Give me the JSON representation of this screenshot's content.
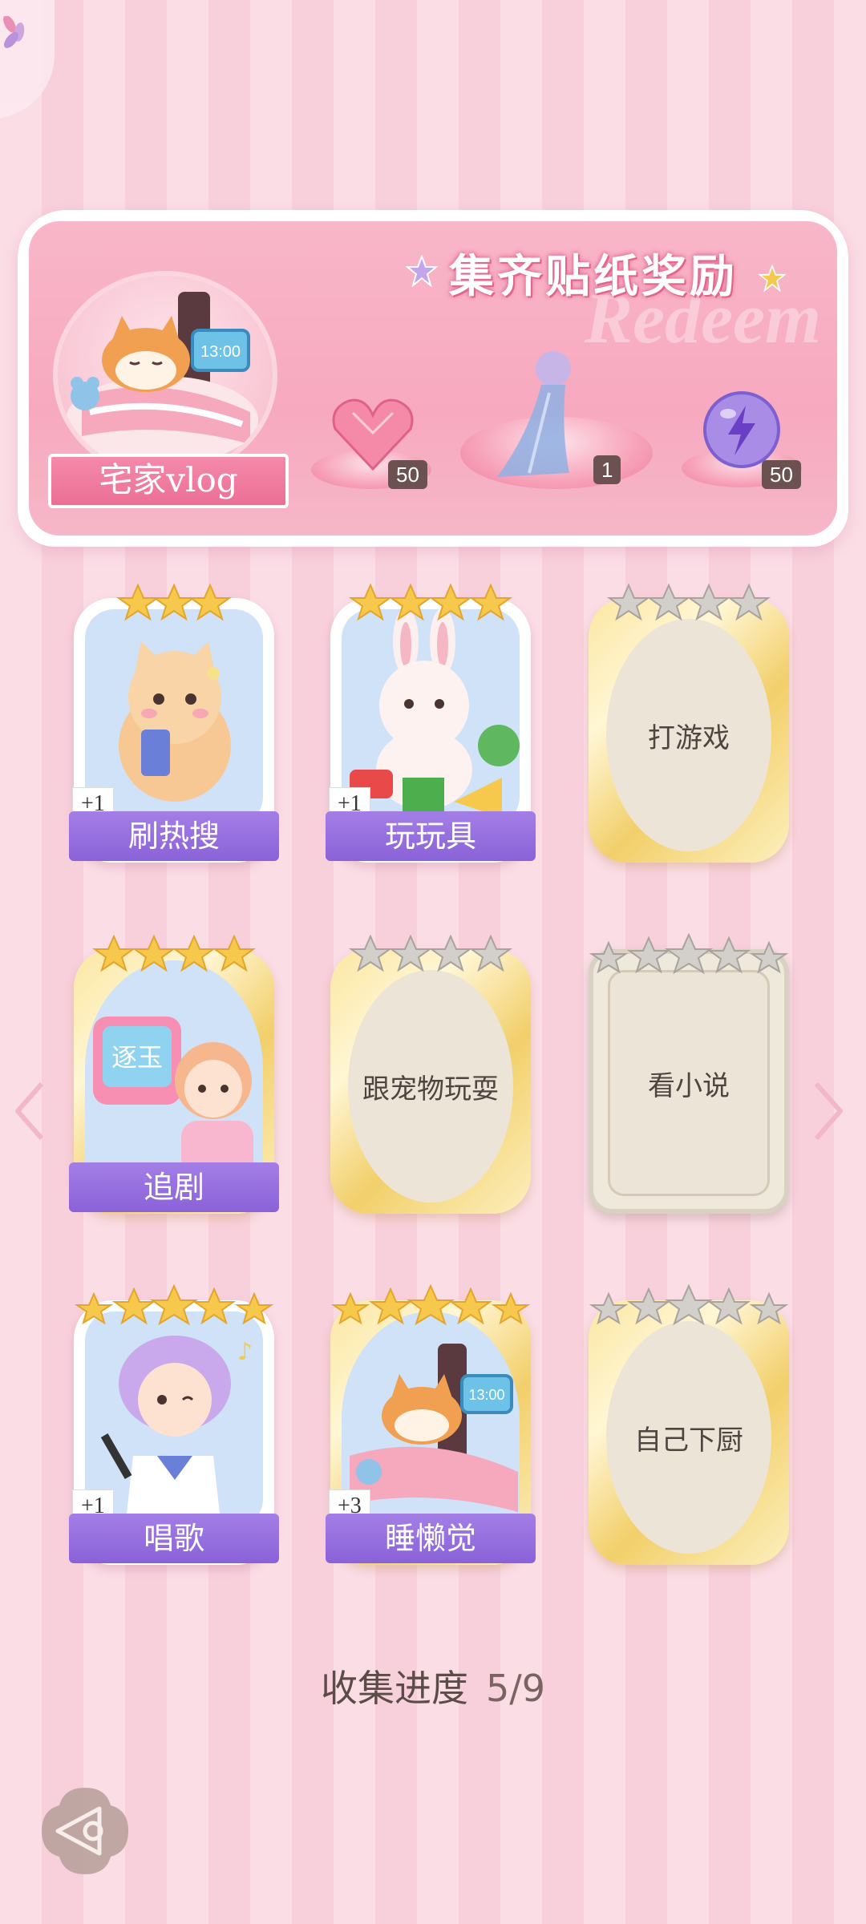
{
  "banner": {
    "title": "集齐贴纸奖励",
    "watermark": "Redeem",
    "theme_label": "宅家vlog",
    "rewards": [
      {
        "name": "heart-gem",
        "count": "50"
      },
      {
        "name": "outfit",
        "count": "1"
      },
      {
        "name": "energy-orb",
        "count": "50"
      }
    ]
  },
  "cards": [
    {
      "label": "刷热搜",
      "status": "collected",
      "stars": 3,
      "bonus": "+1"
    },
    {
      "label": "玩玩具",
      "status": "collected",
      "stars": 4,
      "bonus": "+1"
    },
    {
      "label": "打游戏",
      "status": "locked",
      "stars": 4,
      "bonus": ""
    },
    {
      "label": "追剧",
      "status": "collected",
      "stars": 4,
      "bonus": "",
      "tv_text": "逐玉"
    },
    {
      "label": "跟宠物玩耍",
      "status": "locked",
      "stars": 4,
      "bonus": ""
    },
    {
      "label": "看小说",
      "status": "locked",
      "stars": 5,
      "bonus": ""
    },
    {
      "label": "唱歌",
      "status": "collected",
      "stars": 5,
      "bonus": "+1"
    },
    {
      "label": "睡懒觉",
      "status": "collected",
      "stars": 5,
      "bonus": "+3",
      "clock_text": "13:00"
    },
    {
      "label": "自己下厨",
      "status": "locked",
      "stars": 5,
      "bonus": ""
    }
  ],
  "clock_text": "13:00",
  "progress": {
    "label": "收集进度",
    "value": "5/9"
  },
  "colors": {
    "accent_purple": "#8a62d8",
    "banner_pink": "#f7a9bf",
    "gold_star": "#f6c94c",
    "silver_star": "#c9c4c0"
  }
}
